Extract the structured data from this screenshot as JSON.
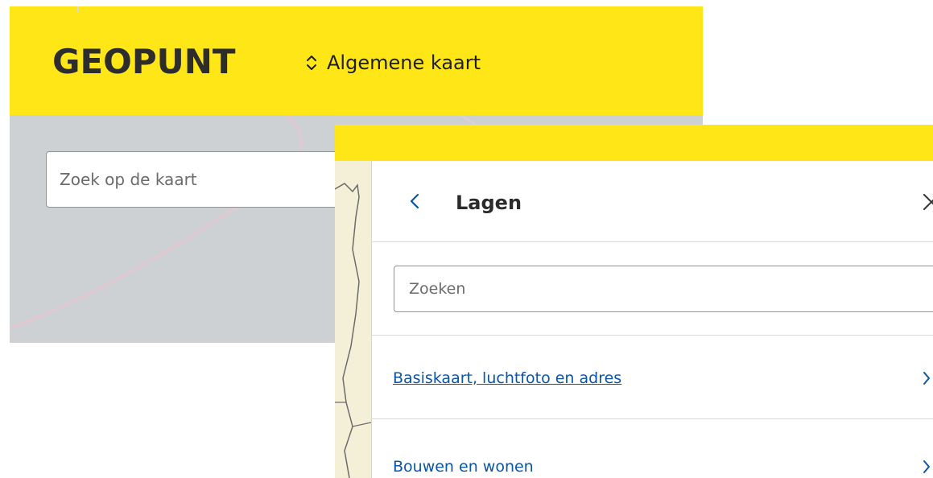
{
  "colors": {
    "header_yellow": "#ffe617",
    "map_grey": "#cdd1d4",
    "link_blue": "#0b55a8",
    "text_dark": "#2d2d2d"
  },
  "header": {
    "logo": "GEOPUNT",
    "map_switch_icon": "sort-arrows-icon",
    "map_switch_label": "Algemene kaart"
  },
  "map_search": {
    "placeholder": "Zoek op de kaart"
  },
  "layers_panel": {
    "back_icon": "chevron-left-icon",
    "title": "Lagen",
    "close_icon": "close-icon",
    "search_placeholder": "Zoeken",
    "categories": [
      {
        "label": "Basiskaart, luchtfoto en adres",
        "icon": "chevron-right-icon"
      },
      {
        "label": "Bouwen en wonen",
        "icon": "chevron-right-icon"
      }
    ]
  }
}
